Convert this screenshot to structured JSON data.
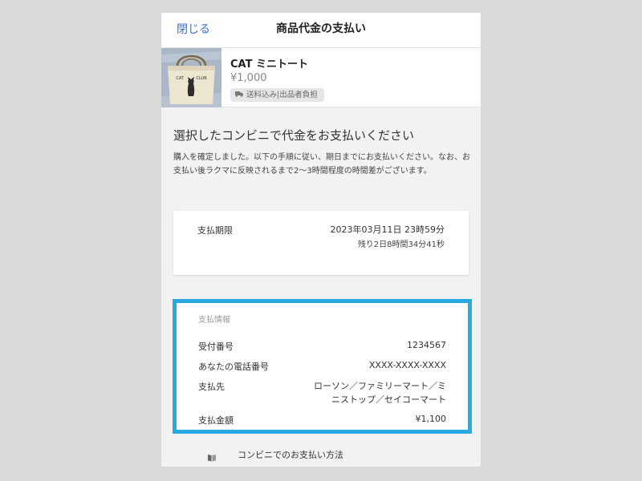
{
  "header": {
    "close_label": "閉じる",
    "title": "商品代金の支払い"
  },
  "product": {
    "image_text": "CAT CLUB",
    "name": "CAT ミニトート",
    "price": "¥1,000",
    "shipping_icon": "truck-icon",
    "shipping_label": "送料込み|出品者負担"
  },
  "main": {
    "section_title": "選択したコンビニで代金をお支払いください",
    "description": "購入を確定しました。以下の手順に従い、期日までにお支払いください。なお、お支払い後ラクマに反映されるまで2〜3時間程度の時間差がございます。"
  },
  "deadline": {
    "label": "支払期限",
    "date": "2023年03月11日 23時59分",
    "remaining": "残り2日8時間34分41秒"
  },
  "payment": {
    "heading": "支払情報",
    "rows": [
      {
        "label": "受付番号",
        "value": "1234567"
      },
      {
        "label": "あなたの電話番号",
        "value": "XXXX-XXXX-XXXX"
      },
      {
        "label": "支払先",
        "value": "ローソン／ファミリーマート／ミニストップ／セイコーマート"
      },
      {
        "label": "支払金額",
        "value": "¥1,100"
      }
    ],
    "highlight_color": "#29a9e1"
  },
  "help": {
    "icon": "book-icon",
    "label": "コンビニでのお支払い方法"
  },
  "colors": {
    "link": "#3a6fc8",
    "background": "#f3f2f2"
  }
}
